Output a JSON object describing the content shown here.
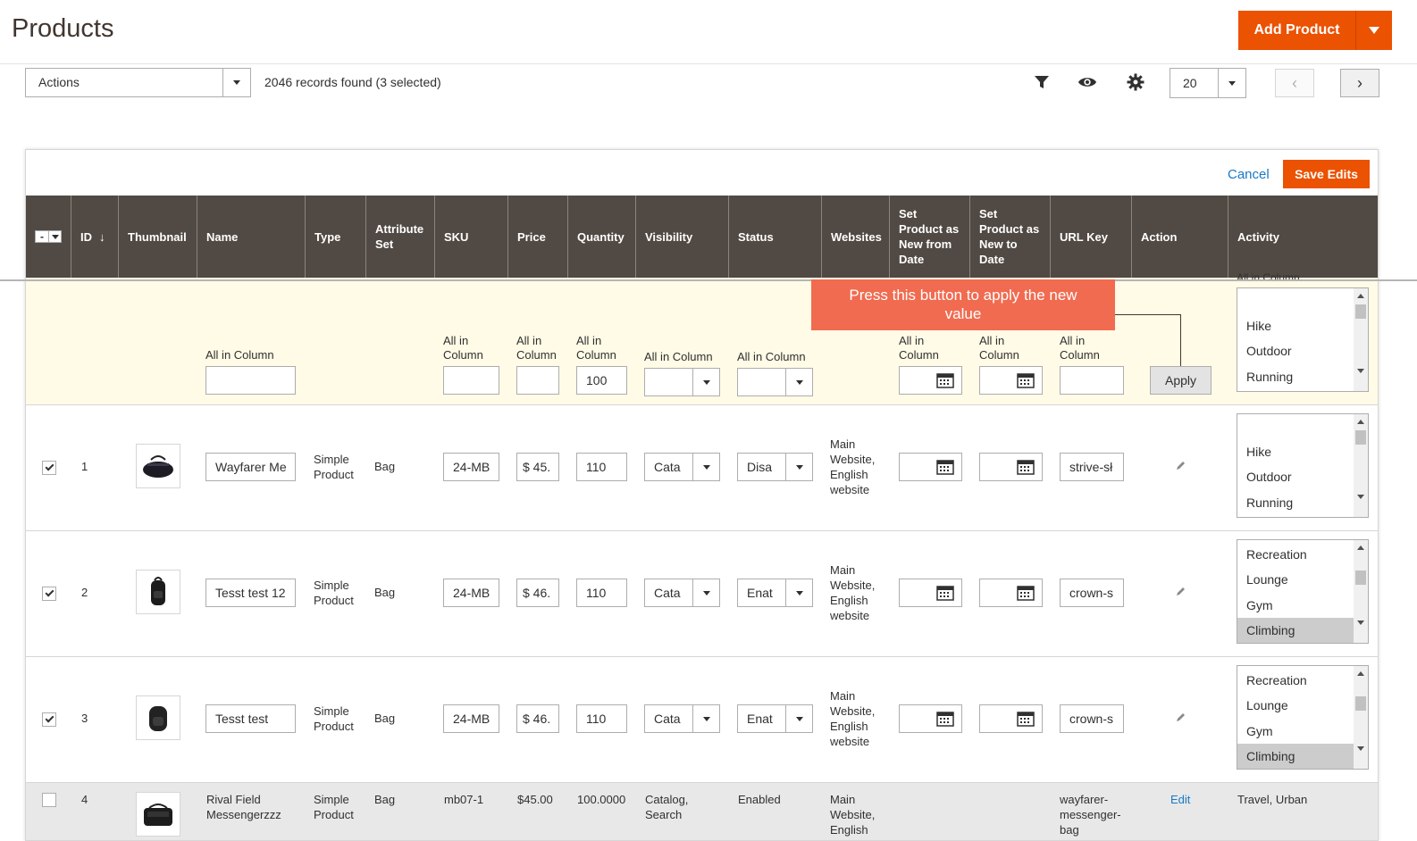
{
  "page": {
    "title": "Products"
  },
  "add_product": {
    "label": "Add Product"
  },
  "toolbar": {
    "actions_label": "Actions",
    "records_text": "2046 records found (3 selected)",
    "per_page": "20"
  },
  "edit_bar": {
    "cancel": "Cancel",
    "save": "Save Edits"
  },
  "columns": {
    "id": "ID",
    "thumbnail": "Thumbnail",
    "name": "Name",
    "type": "Type",
    "attribute_set_1": "Attribute",
    "attribute_set_2": "Set",
    "sku": "SKU",
    "price": "Price",
    "quantity": "Quantity",
    "visibility": "Visibility",
    "status": "Status",
    "websites": "Websites",
    "new_from_1": "Set",
    "new_from_2": "Product as",
    "new_from_3": "New from",
    "new_from_4": "Date",
    "new_to_1": "Set",
    "new_to_2": "Product as",
    "new_to_3": "New to",
    "new_to_4": "Date",
    "url_key": "URL Key",
    "action": "Action",
    "activity": "Activity"
  },
  "mass_edit": {
    "all_in_column": "All in Column",
    "all_in": "All in",
    "column": "Column",
    "quantity_value": "100",
    "apply": "Apply",
    "activity_options": [
      "Hike",
      "Outdoor",
      "Running"
    ],
    "activity_cut_label": "All in Column"
  },
  "tooltip": {
    "line1": "Press this button to apply the new",
    "line2": "value"
  },
  "rows": [
    {
      "id": "1",
      "name": "Wayfarer Me",
      "type_1": "Simple",
      "type_2": "Product",
      "attr": "Bag",
      "sku": "24-MB",
      "price": "$ 45.",
      "qty": "110",
      "visibility": "Cata",
      "status": "Disa",
      "web_1": "Main",
      "web_2": "Website,",
      "web_3": "English",
      "web_4": "website",
      "url": "strive-sł",
      "activity": [
        "Hike",
        "Outdoor",
        "Running"
      ]
    },
    {
      "id": "2",
      "name": "Tesst test 12",
      "type_1": "Simple",
      "type_2": "Product",
      "attr": "Bag",
      "sku": "24-MB",
      "price": "$ 46.",
      "qty": "110",
      "visibility": "Cata",
      "status": "Enat",
      "web_1": "Main",
      "web_2": "Website,",
      "web_3": "English",
      "web_4": "website",
      "url": "crown-s",
      "activity": [
        "Recreation",
        "Lounge",
        "Gym",
        "Climbing"
      ]
    },
    {
      "id": "3",
      "name": "Tesst test",
      "type_1": "Simple",
      "type_2": "Product",
      "attr": "Bag",
      "sku": "24-MB",
      "price": "$ 46.",
      "qty": "110",
      "visibility": "Cata",
      "status": "Enat",
      "web_1": "Main",
      "web_2": "Website,",
      "web_3": "English",
      "web_4": "website",
      "url": "crown-s",
      "activity": [
        "Recreation",
        "Lounge",
        "Gym",
        "Climbing"
      ]
    },
    {
      "id": "4",
      "name_1": "Rival Field",
      "name_2": "Messengerzzz",
      "type_1": "Simple",
      "type_2": "Product",
      "attr": "Bag",
      "sku": "mb07-1",
      "price": "$45.00",
      "qty": "100.0000",
      "visibility_1": "Catalog,",
      "visibility_2": "Search",
      "status": "Enabled",
      "web_1": "Main",
      "web_2": "Website,",
      "web_3": "English",
      "url_1": "wayfarer-",
      "url_2": "messenger-",
      "url_3": "bag",
      "action": "Edit",
      "activity": "Travel, Urban"
    }
  ],
  "colors": {
    "accent": "#eb5202",
    "header_bg": "#514943",
    "tooltip_bg": "#f16b50",
    "mass_row_bg": "#fffbe6",
    "link": "#1979c3"
  }
}
